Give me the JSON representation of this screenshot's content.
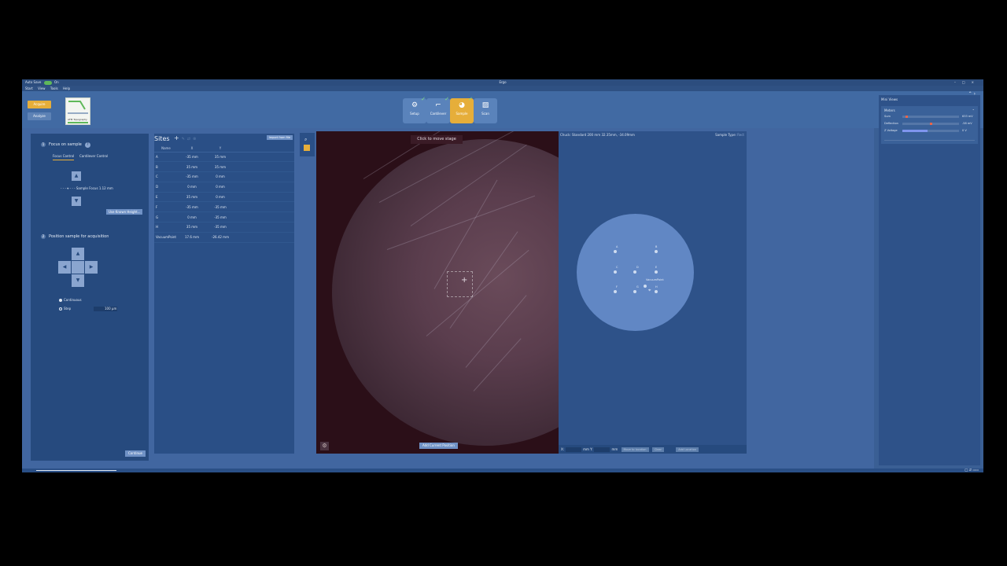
{
  "window": {
    "autosave_label": "Auto Save",
    "autosave_state": "On",
    "title": "Ergo"
  },
  "menu": [
    "Start",
    "View",
    "Tools",
    "Help"
  ],
  "ribbon": {
    "acquire": "Acquire",
    "analyze": "Analyze",
    "mode_thumb_label": "AFM Topography",
    "steps": [
      {
        "label": "Setup",
        "icon": "gear-icon",
        "done": true
      },
      {
        "label": "Cantilever",
        "icon": "cantilever-icon",
        "done": true
      },
      {
        "label": "Sample",
        "icon": "sample-icon",
        "done": true,
        "active": true
      },
      {
        "label": "Scan",
        "icon": "scan-icon",
        "done": false
      }
    ]
  },
  "left_panel": {
    "focus": {
      "number": "1",
      "title": "Focus on sample",
      "tab_focus": "Focus Control",
      "tab_cantilever": "Cantilever Control",
      "sample_focus_label": "Sample Focus",
      "sample_focus_value": "1.12 mm",
      "use_known_height": "Use Known Height..."
    },
    "position": {
      "number": "2",
      "title": "Position sample for acquisition",
      "continuous": "Continuous",
      "step": "Step",
      "step_value": "100 µm"
    },
    "continue": "Continue"
  },
  "sites": {
    "title": "Sites",
    "import": "Import from file",
    "columns": [
      "Name",
      "X",
      "Y"
    ],
    "rows": [
      {
        "name": "A",
        "x": "-35 mm",
        "y": "35 mm"
      },
      {
        "name": "B",
        "x": "35 mm",
        "y": "35 mm"
      },
      {
        "name": "C",
        "x": "-35 mm",
        "y": "0 mm"
      },
      {
        "name": "D",
        "x": "0 mm",
        "y": "0 mm"
      },
      {
        "name": "E",
        "x": "35 mm",
        "y": "0 mm"
      },
      {
        "name": "F",
        "x": "-35 mm",
        "y": "-35 mm"
      },
      {
        "name": "G",
        "x": "0 mm",
        "y": "-35 mm"
      },
      {
        "name": "H",
        "x": "35 mm",
        "y": "-35 mm"
      },
      {
        "name": "VacuumPoint",
        "x": "17.6 mm",
        "y": "-26.42 mm"
      }
    ]
  },
  "camera": {
    "tooltip": "Click to move stage",
    "add_current": "Add Current Position"
  },
  "chuck": {
    "header": "Chuck: Standard 200 mm    32.35mm, -34.09mm",
    "sample_type_label": "Sample Type:",
    "sample_type_value": "Rect",
    "x_label": "X:",
    "x_unit": "mm",
    "y_label": "Y:",
    "y_unit": "mm",
    "btn_move": "Move to location",
    "btn_clear": "Clear",
    "btn_add": "Add Location",
    "labels": {
      "a": "A",
      "b": "B",
      "c": "C",
      "d": "D",
      "e": "E",
      "f": "F",
      "g": "G",
      "h": "H",
      "vp": "VacuumPoint"
    }
  },
  "mini_views": {
    "title": "Mini Views",
    "meters_title": "Meters",
    "rows": [
      {
        "label": "Sum",
        "value": "633 mV",
        "fill": 0.05,
        "color": "#e8664b"
      },
      {
        "label": "Deflection",
        "value": "-58 mV",
        "fill": 0.48,
        "color": "#e8664b"
      },
      {
        "label": "Z Voltage",
        "value": "0 V",
        "fill": 0.45,
        "color": "#7f95ef"
      }
    ]
  }
}
